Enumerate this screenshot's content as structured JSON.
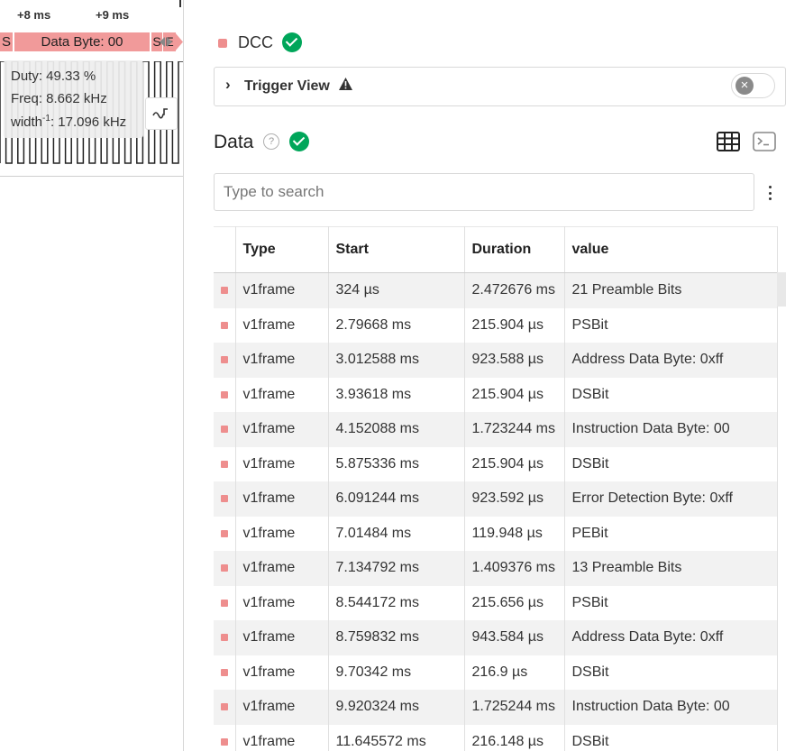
{
  "waveform": {
    "time_labels": [
      "+8 ms",
      "+9 ms"
    ],
    "decoder_segments": [
      "S",
      "Data Byte: 00",
      "S",
      "E"
    ],
    "measurements": {
      "duty": "Duty: 49.33 %",
      "freq": "Freq: 8.662 kHz",
      "width_prefix": "width",
      "width_exp": "-1",
      "width_value": ": 17.096 kHz"
    },
    "measure_button_icon": "measure-waveform-icon"
  },
  "panel": {
    "analyzer_name": "DCC",
    "analyzer_color": "#ee8e8e",
    "status_color": "#00a65a",
    "trigger": {
      "label": "Trigger View",
      "toggle_icon": "close-icon",
      "toggle_on": false
    },
    "data": {
      "title": "Data",
      "help_icon": "help-icon",
      "view_icons": [
        "table-view-icon",
        "terminal-view-icon"
      ],
      "search_placeholder": "Type to search",
      "columns": [
        "Type",
        "Start",
        "Duration",
        "value"
      ],
      "rows": [
        {
          "type": "v1frame",
          "start": "324 µs",
          "duration": "2.472676 ms",
          "value": "21 Preamble Bits"
        },
        {
          "type": "v1frame",
          "start": "2.79668 ms",
          "duration": "215.904 µs",
          "value": "PSBit"
        },
        {
          "type": "v1frame",
          "start": "3.012588 ms",
          "duration": "923.588 µs",
          "value": "Address Data Byte: 0xff"
        },
        {
          "type": "v1frame",
          "start": "3.93618 ms",
          "duration": "215.904 µs",
          "value": "DSBit"
        },
        {
          "type": "v1frame",
          "start": "4.152088 ms",
          "duration": "1.723244 ms",
          "value": "Instruction Data Byte: 00"
        },
        {
          "type": "v1frame",
          "start": "5.875336 ms",
          "duration": "215.904 µs",
          "value": "DSBit"
        },
        {
          "type": "v1frame",
          "start": "6.091244 ms",
          "duration": "923.592 µs",
          "value": "Error Detection Byte: 0xff"
        },
        {
          "type": "v1frame",
          "start": "7.01484 ms",
          "duration": "119.948 µs",
          "value": "PEBit"
        },
        {
          "type": "v1frame",
          "start": "7.134792 ms",
          "duration": "1.409376 ms",
          "value": "13 Preamble Bits"
        },
        {
          "type": "v1frame",
          "start": "8.544172 ms",
          "duration": "215.656 µs",
          "value": "PSBit"
        },
        {
          "type": "v1frame",
          "start": "8.759832 ms",
          "duration": "943.584 µs",
          "value": "Address Data Byte: 0xff"
        },
        {
          "type": "v1frame",
          "start": "9.70342 ms",
          "duration": "216.9 µs",
          "value": "DSBit"
        },
        {
          "type": "v1frame",
          "start": "9.920324 ms",
          "duration": "1.725244 ms",
          "value": "Instruction Data Byte: 00"
        },
        {
          "type": "v1frame",
          "start": "11.645572 ms",
          "duration": "216.148 µs",
          "value": "DSBit"
        }
      ]
    }
  }
}
